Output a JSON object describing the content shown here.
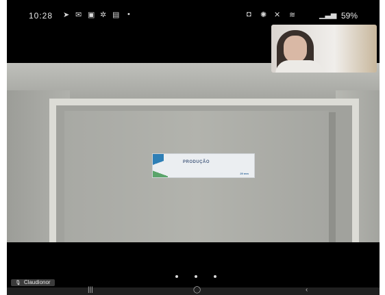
{
  "status_bar": {
    "time": "10:28",
    "battery": "59%",
    "left_icons": [
      "navigation-icon",
      "mail-icon",
      "gallery-icon",
      "settings-icon",
      "photo-icon",
      "dot-icon"
    ],
    "right_icons": [
      "nfc-icon",
      "vibrate-icon",
      "mute-icon",
      "wifi-icon",
      "signal-icon"
    ]
  },
  "video": {
    "sign_title": "PRODUÇÃO",
    "sign_brand": "29 mm"
  },
  "participant": {
    "name": "Claudionor",
    "mic_icon": "mic-icon"
  },
  "page_indicator": {
    "count": 3,
    "active": 2
  },
  "navbar": {
    "recents_icon": "recents-icon",
    "home_icon": "home-icon",
    "back_icon": "back-icon"
  }
}
